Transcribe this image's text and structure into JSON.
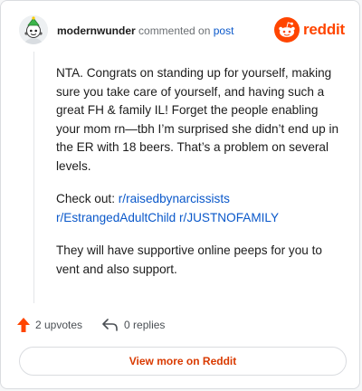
{
  "header": {
    "username": "modernwunder",
    "action_text": "commented on",
    "post_link": "post",
    "brand_name": "reddit",
    "brand_color": "#ff4500"
  },
  "comment": {
    "paragraph1": "NTA. Congrats on standing up for yourself, making sure you take care of yourself, and having such a great FH & family IL! Forget the people enabling your mom rn—tbh I’m surprised she didn’t end up in the ER with 18 beers. That’s a problem on several levels.",
    "check_out_label": "Check out:",
    "subreddits": [
      "r/raisedbynarcissists",
      "r/EstrangedAdultChild",
      "r/JUSTNOFAMILY"
    ],
    "paragraph3": "They will have supportive online peeps for you to vent and also support."
  },
  "actions": {
    "upvotes_label": "2 upvotes",
    "replies_label": "0 replies",
    "upvote_icon": "upvote-arrow-icon",
    "reply_icon": "reply-arrow-icon"
  },
  "footer": {
    "view_more_label": "View more on Reddit",
    "accent": "#d93a00"
  },
  "colors": {
    "link": "#0a58ca",
    "text": "#1c1c1c"
  }
}
